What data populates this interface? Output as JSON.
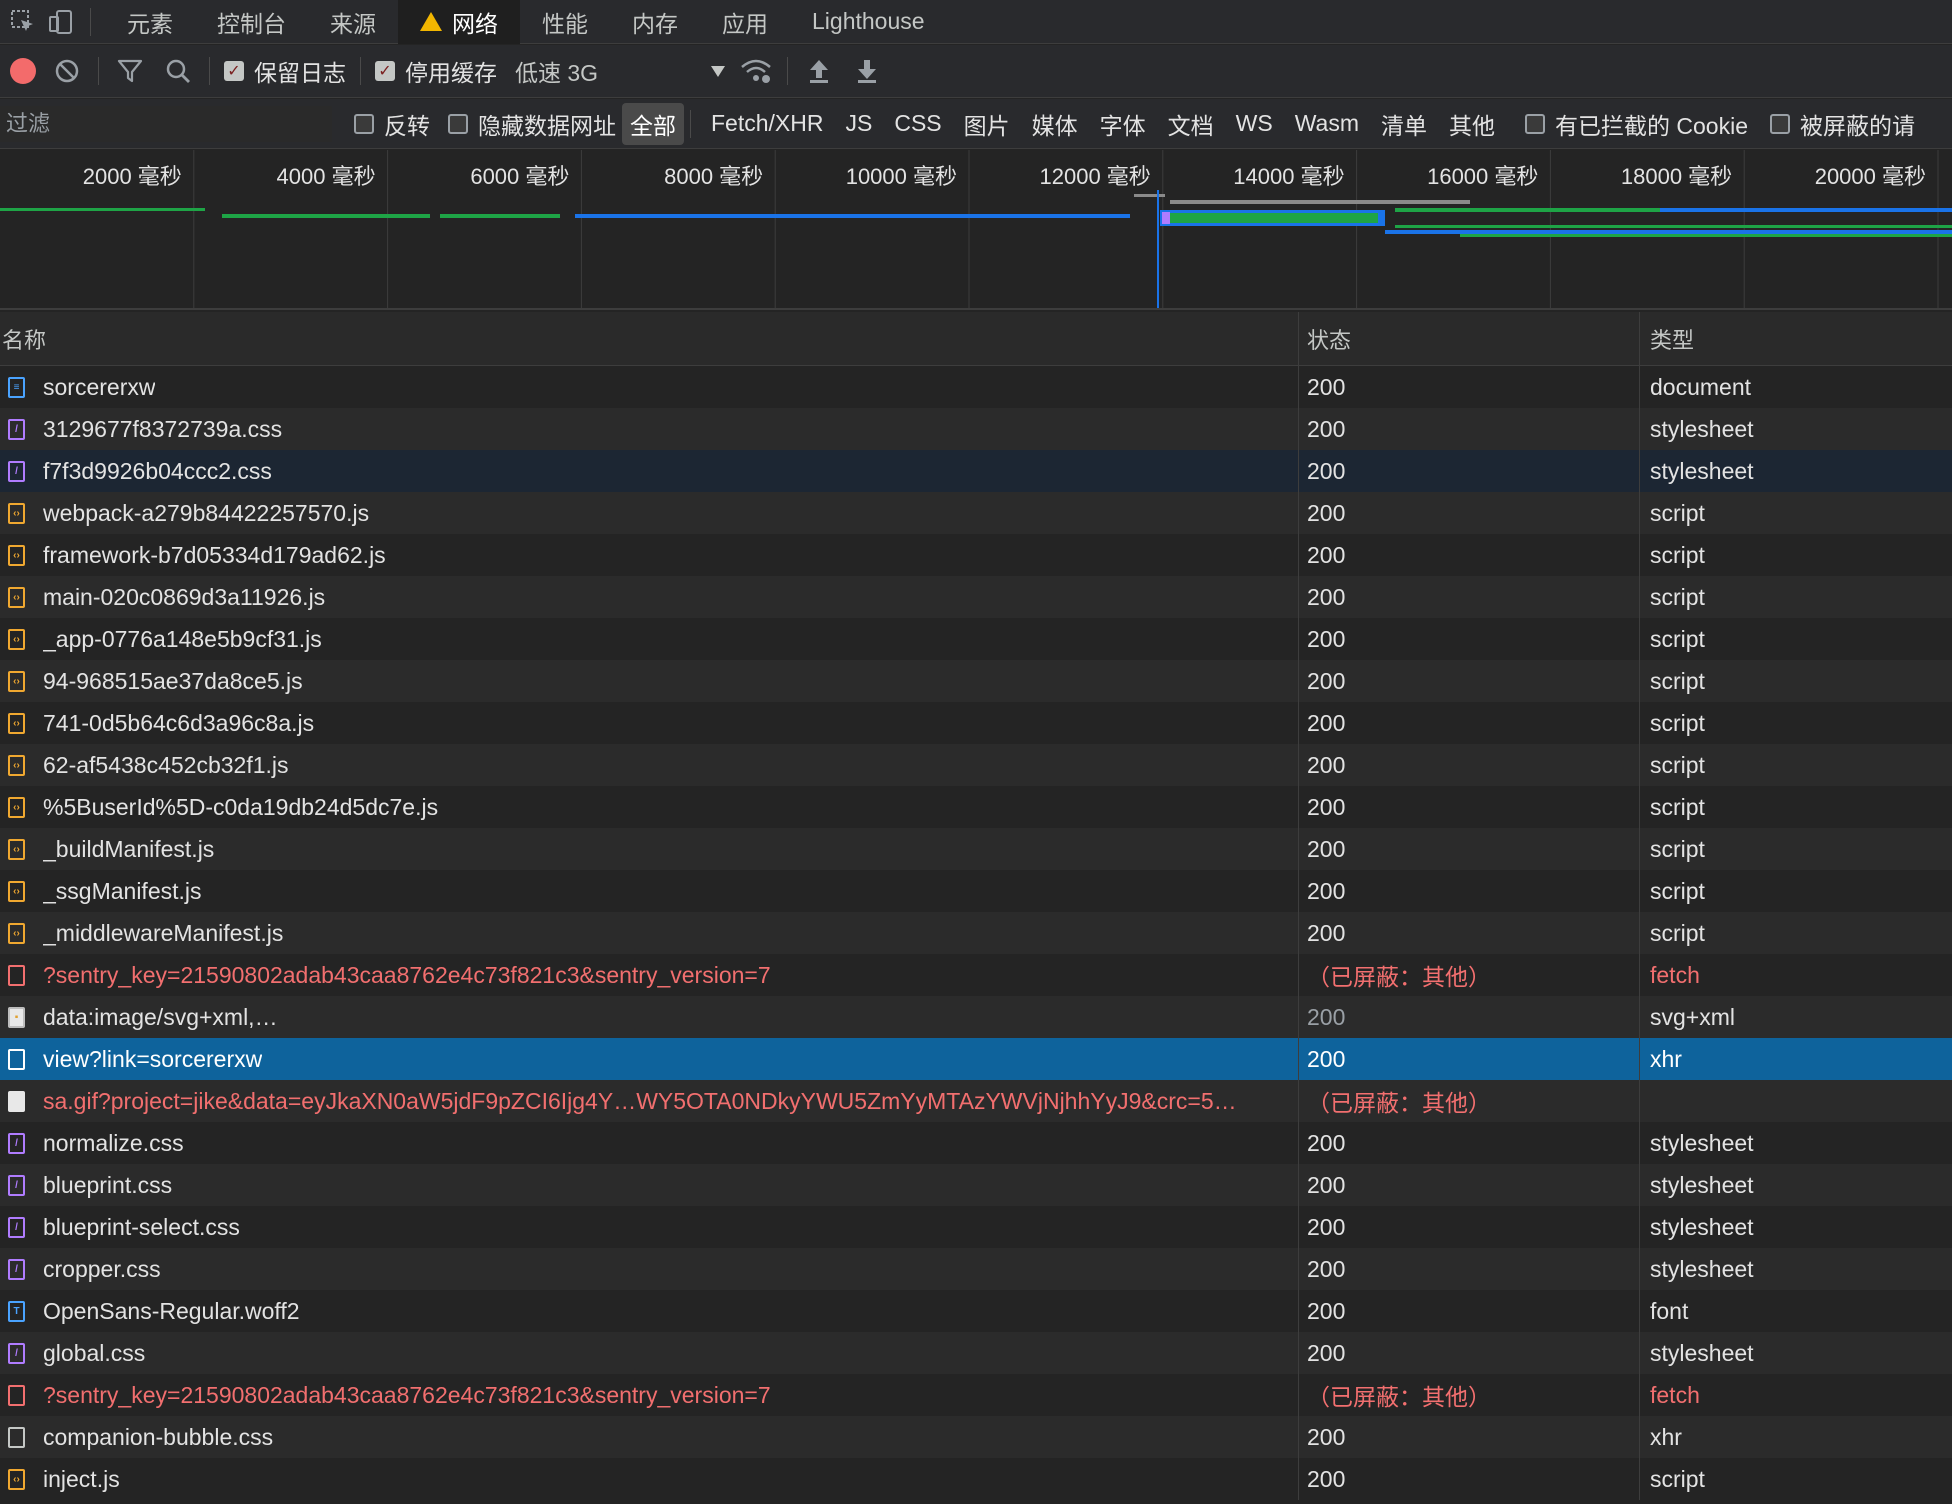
{
  "tabs": {
    "items": [
      {
        "label": "元素"
      },
      {
        "label": "控制台"
      },
      {
        "label": "来源"
      },
      {
        "label": "网络"
      },
      {
        "label": "性能"
      },
      {
        "label": "内存"
      },
      {
        "label": "应用"
      },
      {
        "label": "Lighthouse"
      }
    ],
    "active_index": 3,
    "active_warning_icon": "warning-triangle-icon"
  },
  "toolbar": {
    "preserve_log": {
      "label": "保留日志",
      "checked": true
    },
    "disable_cache": {
      "label": "停用缓存",
      "checked": true
    },
    "throttling": {
      "value": "低速 3G"
    },
    "icons": [
      "record-icon",
      "clear-icon",
      "filter-icon",
      "search-icon",
      "network-conditions-icon",
      "import-har-icon",
      "export-har-icon"
    ]
  },
  "filterbar": {
    "placeholder": "过滤",
    "invert": {
      "label": "反转",
      "checked": false
    },
    "hide_data_urls": {
      "label": "隐藏数据网址",
      "checked": false
    },
    "types": [
      "全部",
      "Fetch/XHR",
      "JS",
      "CSS",
      "图片",
      "媒体",
      "字体",
      "文档",
      "WS",
      "Wasm",
      "清单",
      "其他"
    ],
    "active_type": "全部",
    "blocked_cookies": {
      "label": "有已拦截的 Cookie",
      "checked": false
    },
    "blocked_requests": {
      "label": "被屏蔽的请",
      "checked": false
    }
  },
  "overview": {
    "ticks": [
      "2000 毫秒",
      "4000 毫秒",
      "6000 毫秒",
      "8000 毫秒",
      "10000 毫秒",
      "12000 毫秒",
      "14000 毫秒",
      "16000 毫秒",
      "18000 毫秒",
      "20000 毫秒"
    ]
  },
  "table": {
    "headers": {
      "name": "名称",
      "status": "状态",
      "type": "类型"
    },
    "rows": [
      {
        "name": "sorcererxw",
        "status": "200",
        "type": "document",
        "icon": "document-icon"
      },
      {
        "name": "3129677f8372739a.css",
        "status": "200",
        "type": "stylesheet",
        "icon": "stylesheet-icon"
      },
      {
        "name": "f7f3d9926b04ccc2.css",
        "status": "200",
        "type": "stylesheet",
        "icon": "stylesheet-icon"
      },
      {
        "name": "webpack-a279b84422257570.js",
        "status": "200",
        "type": "script",
        "icon": "script-icon"
      },
      {
        "name": "framework-b7d05334d179ad62.js",
        "status": "200",
        "type": "script",
        "icon": "script-icon"
      },
      {
        "name": "main-020c0869d3a11926.js",
        "status": "200",
        "type": "script",
        "icon": "script-icon"
      },
      {
        "name": "_app-0776a148e5b9cf31.js",
        "status": "200",
        "type": "script",
        "icon": "script-icon"
      },
      {
        "name": "94-968515ae37da8ce5.js",
        "status": "200",
        "type": "script",
        "icon": "script-icon"
      },
      {
        "name": "741-0d5b64c6d3a96c8a.js",
        "status": "200",
        "type": "script",
        "icon": "script-icon"
      },
      {
        "name": "62-af5438c452cb32f1.js",
        "status": "200",
        "type": "script",
        "icon": "script-icon"
      },
      {
        "name": "%5BuserId%5D-c0da19db24d5dc7e.js",
        "status": "200",
        "type": "script",
        "icon": "script-icon"
      },
      {
        "name": "_buildManifest.js",
        "status": "200",
        "type": "script",
        "icon": "script-icon"
      },
      {
        "name": "_ssgManifest.js",
        "status": "200",
        "type": "script",
        "icon": "script-icon"
      },
      {
        "name": "_middlewareManifest.js",
        "status": "200",
        "type": "script",
        "icon": "script-icon"
      },
      {
        "name": "?sentry_key=21590802adab43caa8762e4c73f821c3&sentry_version=7",
        "status": "（已屏蔽：其他）",
        "type": "fetch",
        "icon": "fetch-icon",
        "blocked": true
      },
      {
        "name": "data:image/svg+xml,…",
        "status": "200",
        "type": "svg+xml",
        "icon": "image-icon",
        "dim": true
      },
      {
        "name": "view?link=sorcererxw",
        "status": "200",
        "type": "xhr",
        "icon": "xhr-icon",
        "selected": true
      },
      {
        "name": "sa.gif?project=jike&data=eyJkaXN0aW5jdF9pZCI6Ijg4Y…WY5OTA0NDkyYWU5ZmYyMTAzYWVjNjhhYyJ9&crc=5…",
        "status": "（已屏蔽：其他）",
        "type": "",
        "icon": "gif-icon",
        "blocked": true
      },
      {
        "name": "normalize.css",
        "status": "200",
        "type": "stylesheet",
        "icon": "stylesheet-icon"
      },
      {
        "name": "blueprint.css",
        "status": "200",
        "type": "stylesheet",
        "icon": "stylesheet-icon"
      },
      {
        "name": "blueprint-select.css",
        "status": "200",
        "type": "stylesheet",
        "icon": "stylesheet-icon"
      },
      {
        "name": "cropper.css",
        "status": "200",
        "type": "stylesheet",
        "icon": "stylesheet-icon"
      },
      {
        "name": "OpenSans-Regular.woff2",
        "status": "200",
        "type": "font",
        "icon": "font-icon"
      },
      {
        "name": "global.css",
        "status": "200",
        "type": "stylesheet",
        "icon": "stylesheet-icon"
      },
      {
        "name": "?sentry_key=21590802adab43caa8762e4c73f821c3&sentry_version=7",
        "status": "（已屏蔽：其他）",
        "type": "fetch",
        "icon": "fetch-icon",
        "blocked": true
      },
      {
        "name": "companion-bubble.css",
        "status": "200",
        "type": "xhr",
        "icon": "xhr-icon"
      },
      {
        "name": "inject.js",
        "status": "200",
        "type": "script",
        "icon": "script-icon"
      }
    ]
  },
  "colors": {
    "background": "#242424",
    "selected_row": "#0e639c",
    "blocked_text": "#f26f6f",
    "record": "#f36b6b",
    "timeline_green": "#1ea446",
    "timeline_blue": "#1a73e8"
  }
}
